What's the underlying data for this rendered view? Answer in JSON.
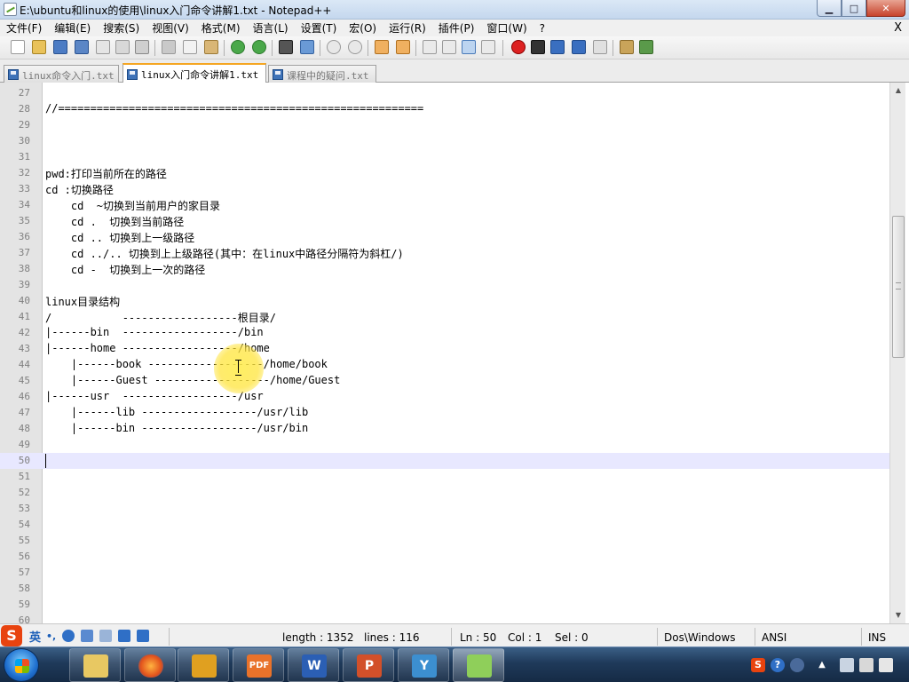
{
  "window": {
    "title": "E:\\ubuntu和linux的使用\\linux入门命令讲解1.txt - Notepad++",
    "controls": {
      "minimize": "▁",
      "maximize": "□",
      "close": "✕"
    }
  },
  "menu": {
    "items": [
      "文件(F)",
      "编辑(E)",
      "搜索(S)",
      "视图(V)",
      "格式(M)",
      "语言(L)",
      "设置(T)",
      "宏(O)",
      "运行(R)",
      "插件(P)",
      "窗口(W)",
      "?"
    ],
    "close_glyph": "X"
  },
  "tabs": [
    {
      "label": "linux命令入门.txt",
      "active": false
    },
    {
      "label": "linux入门命令讲解1.txt",
      "active": true
    },
    {
      "label": "课程中的疑问.txt",
      "active": false
    }
  ],
  "editor": {
    "current_line": 50,
    "lines": [
      {
        "n": "27",
        "text": ""
      },
      {
        "n": "28",
        "text": "//========================================================="
      },
      {
        "n": "29",
        "text": ""
      },
      {
        "n": "30",
        "text": ""
      },
      {
        "n": "31",
        "text": ""
      },
      {
        "n": "32",
        "text": "pwd:打印当前所在的路径"
      },
      {
        "n": "33",
        "text": "cd :切换路径"
      },
      {
        "n": "34",
        "text": "    cd  ~切换到当前用户的家目录"
      },
      {
        "n": "35",
        "text": "    cd .  切换到当前路径"
      },
      {
        "n": "36",
        "text": "    cd .. 切换到上一级路径"
      },
      {
        "n": "37",
        "text": "    cd ../.. 切换到上上级路径(其中：在linux中路径分隔符为斜杠/)"
      },
      {
        "n": "38",
        "text": "    cd -  切换到上一次的路径"
      },
      {
        "n": "39",
        "text": ""
      },
      {
        "n": "40",
        "text": "linux目录结构"
      },
      {
        "n": "41",
        "text": "/           ------------------根目录/"
      },
      {
        "n": "42",
        "text": "|------bin  ------------------/bin"
      },
      {
        "n": "43",
        "text": "|------home ------------------/home"
      },
      {
        "n": "44",
        "text": "    |------book ------------------/home/book"
      },
      {
        "n": "45",
        "text": "    |------Guest ------------------/home/Guest"
      },
      {
        "n": "46",
        "text": "|------usr  ------------------/usr"
      },
      {
        "n": "47",
        "text": "    |------lib ------------------/usr/lib"
      },
      {
        "n": "48",
        "text": "    |------bin ------------------/usr/bin"
      },
      {
        "n": "49",
        "text": ""
      },
      {
        "n": "50",
        "text": ""
      },
      {
        "n": "51",
        "text": ""
      },
      {
        "n": "52",
        "text": ""
      },
      {
        "n": "53",
        "text": ""
      },
      {
        "n": "54",
        "text": ""
      },
      {
        "n": "55",
        "text": ""
      },
      {
        "n": "56",
        "text": ""
      },
      {
        "n": "57",
        "text": ""
      },
      {
        "n": "58",
        "text": ""
      },
      {
        "n": "59",
        "text": ""
      },
      {
        "n": "60",
        "text": ""
      }
    ]
  },
  "status": {
    "ime_logo": "S",
    "ime_mode": "英",
    "ime_punct": "•,",
    "length": "length : 1352",
    "lines": "lines : 116",
    "ln": "Ln : 50",
    "col": "Col : 1",
    "sel": "Sel : 0",
    "eol": "Dos\\Windows",
    "encoding": "ANSI",
    "insert_mode": "INS"
  },
  "taskbar": {
    "apps": [
      {
        "name": "explorer",
        "glyph": ""
      },
      {
        "name": "firefox",
        "glyph": ""
      },
      {
        "name": "xmind",
        "glyph": ""
      },
      {
        "name": "pdf",
        "glyph": "PDF"
      },
      {
        "name": "word",
        "glyph": "W"
      },
      {
        "name": "powerpoint",
        "glyph": "P"
      },
      {
        "name": "tool",
        "glyph": "Y"
      },
      {
        "name": "notepadpp",
        "glyph": ""
      }
    ],
    "tray_logo": "S",
    "tray_help": "?"
  },
  "colors": {
    "current_line": "#e8e8ff",
    "active_tab_accent": "#f5a623",
    "gutter": "#e4e4e4",
    "taskbar": "#1f3a5a"
  }
}
